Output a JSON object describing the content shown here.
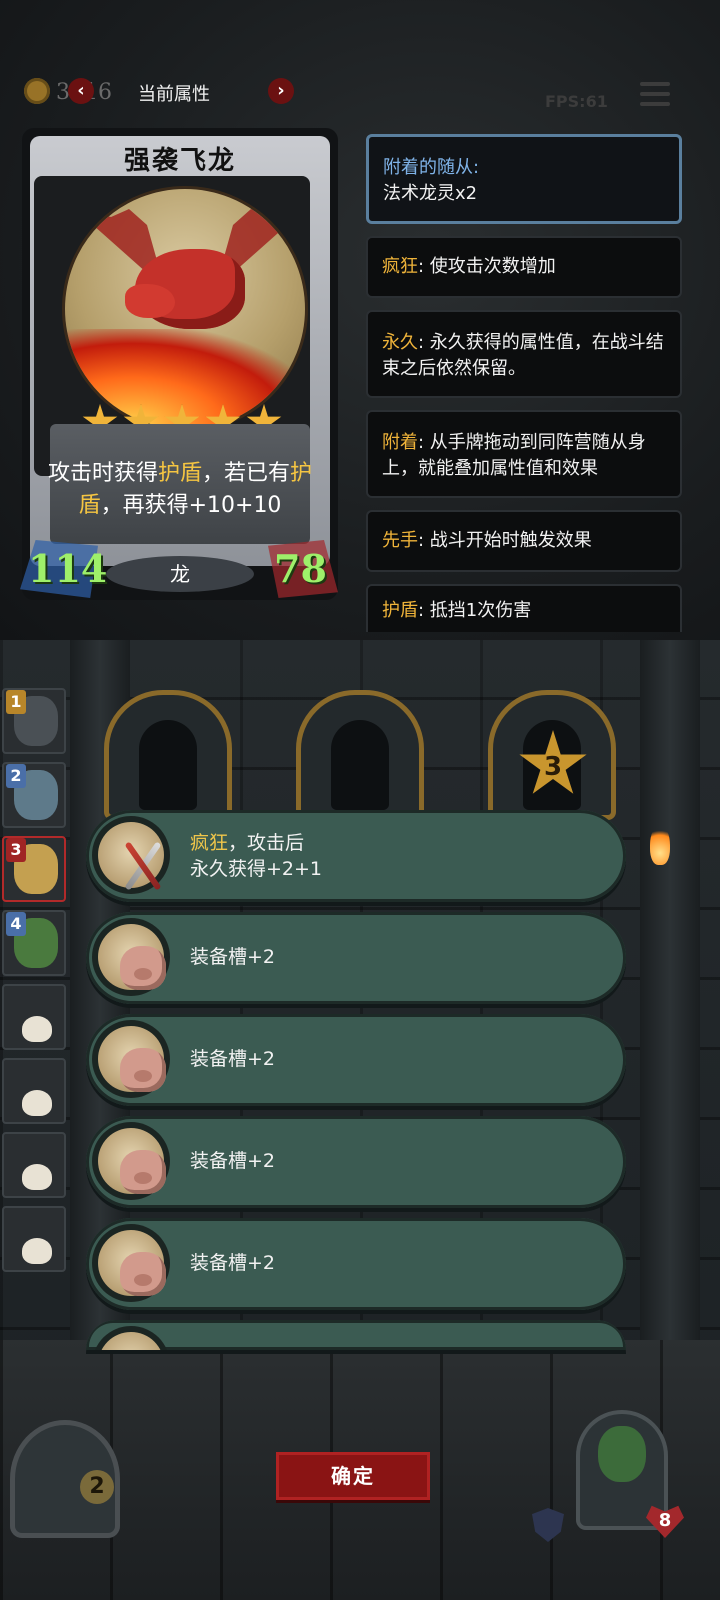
{
  "topbar": {
    "coin_count": "3316",
    "title": "当前属性",
    "prev": "‹",
    "next": "›",
    "fps": "FPS:61"
  },
  "card": {
    "name": "强袭飞龙",
    "stars": 5,
    "desc_parts": [
      "攻击时获得",
      "护盾",
      "，若已有",
      "护盾",
      "，再获得+10+10"
    ],
    "attack": "114",
    "health": "78",
    "type": "龙"
  },
  "keywords": [
    {
      "key": "附着的随从:",
      "text": "法术龙灵x2"
    },
    {
      "key": "疯狂",
      "text": ": 使攻击次数增加"
    },
    {
      "key": "永久",
      "text": ": 永久获得的属性值，在战斗结束之后依然保留。"
    },
    {
      "key": "附着",
      "text": ": 从手牌拖动到同阵营随从身上，就能叠加属性值和效果"
    },
    {
      "key": "先手",
      "text": ": 战斗开始时触发效果"
    },
    {
      "key": "护盾",
      "text": ": 抵挡1次伤害"
    }
  ],
  "team_slots": [
    "1",
    "2",
    "3",
    "4"
  ],
  "arena": {
    "badge": "3"
  },
  "rewards": [
    {
      "key": "疯狂",
      "line1": "，攻击后",
      "line2": "永久获得+2+1"
    },
    {
      "text": "装备槽+2"
    },
    {
      "text": "装备槽+2"
    },
    {
      "text": "装备槽+2"
    },
    {
      "text": "装备槽+2"
    }
  ],
  "bottom": {
    "confirm": "确定",
    "deck_count": "2",
    "hero_hp": "8"
  },
  "colors": {
    "keyword": "#f0b43a",
    "keyword_blue": "#7fb3e8",
    "stat_green": "#9ef06a",
    "reward_bg": "#3b5b52",
    "confirm_bg": "#8a1414"
  }
}
